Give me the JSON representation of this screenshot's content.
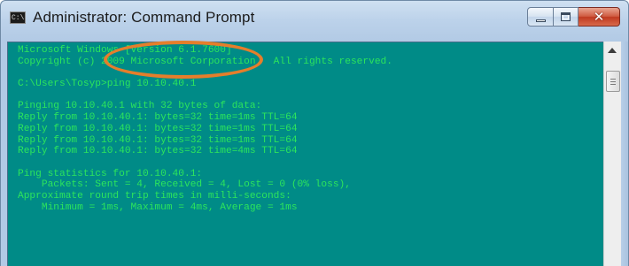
{
  "window": {
    "title": "Administrator: Command Prompt",
    "icon_text": "C:\\",
    "icons": [
      "cmd-app-icon",
      "minimize-icon",
      "maximize-icon",
      "close-icon",
      "scroll-up-arrow-icon"
    ],
    "controls": {
      "close_glyph": "✕"
    }
  },
  "console": {
    "background": "#008b87",
    "text_color": "#2ce55c",
    "lines": [
      "Microsoft Windows [Version 6.1.7600]",
      "Copyright (c) 2009 Microsoft Corporation.  All rights reserved.",
      "",
      "C:\\Users\\Tosyp>ping 10.10.40.1",
      "",
      "Pinging 10.10.40.1 with 32 bytes of data:",
      "Reply from 10.10.40.1: bytes=32 time=1ms TTL=64",
      "Reply from 10.10.40.1: bytes=32 time=1ms TTL=64",
      "Reply from 10.10.40.1: bytes=32 time=1ms TTL=64",
      "Reply from 10.10.40.1: bytes=32 time=4ms TTL=64",
      "",
      "Ping statistics for 10.10.40.1:",
      "    Packets: Sent = 4, Received = 4, Lost = 0 (0% loss),",
      "Approximate round trip times in milli-seconds:",
      "    Minimum = 1ms, Maximum = 4ms, Average = 1ms"
    ]
  },
  "annotation": {
    "color": "#e57e2b"
  }
}
